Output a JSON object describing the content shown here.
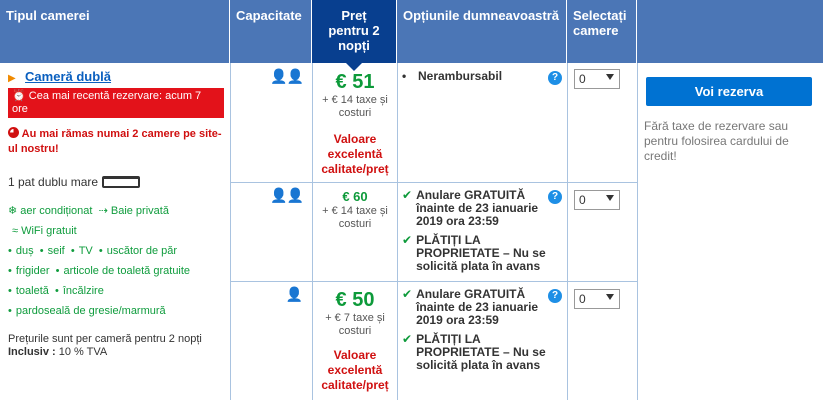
{
  "header": {
    "room_type": "Tipul camerei",
    "capacity": "Capacitate",
    "price_line1": "Preț",
    "price_line2": "pentru 2",
    "price_line3": "nopți",
    "options": "Opțiunile dumneavoastră",
    "select_line1": "Selectați",
    "select_line2": "camere"
  },
  "room": {
    "title": "Cameră dublă",
    "alert": "Cea mai recentă rezervare: acum 7 ore",
    "scarcity": "Au mai rămas numai 2 camere pe site-ul nostru!",
    "bed": "1 pat dublu mare",
    "amenities_row1": [
      "aer condiționat",
      "Baie privată"
    ],
    "wifi": "WiFi gratuit",
    "amenities_row2": [
      "duș",
      "seif",
      "TV",
      "uscător de păr"
    ],
    "amenities_row3": [
      "frigider",
      "articole de toaletă gratuite"
    ],
    "amenities_row4": [
      "toaletă",
      "încălzire"
    ],
    "amenities_row5": [
      "pardoseală de gresie/marmură"
    ],
    "prices_note": "Prețurile sunt per cameră pentru 2 nopți",
    "included_label": "Inclusiv :",
    "included_value": "10 % TVA"
  },
  "rows": [
    {
      "capacity_icon": "two-persons-icon",
      "price": "€ 51",
      "taxes": "+ € 14 taxe și costuri",
      "value_label": "Valoare excelentă calitate/preț",
      "options": [
        {
          "text": "Nerambursabil",
          "style": "bullet"
        }
      ],
      "select_value": "0"
    },
    {
      "capacity_icon": "two-persons-icon",
      "price": "€ 60",
      "taxes": "+ € 14 taxe și costuri",
      "options": [
        {
          "text": "Anulare GRATUITĂ înainte de 23 ianuarie 2019 ora 23:59",
          "style": "check"
        },
        {
          "text": "PLĂTIȚI LA PROPRIETATE – Nu se solicită plata în avans",
          "style": "check"
        }
      ],
      "select_value": "0"
    },
    {
      "capacity_icon": "one-person-icon",
      "price": "€ 50",
      "taxes": "+ € 7 taxe și costuri",
      "value_label": "Valoare excelentă calitate/preț",
      "options": [
        {
          "text": "Anulare GRATUITĂ înainte de 23 ianuarie 2019 ora 23:59",
          "style": "check"
        },
        {
          "text": "PLĂTIȚI LA PROPRIETATE – Nu se solicită plata în avans",
          "style": "check"
        }
      ],
      "select_value": "0"
    }
  ],
  "reserve_button": "Voi rezerva",
  "reserve_note": "Fără taxe de rezervare sau pentru folosirea cardului de credit!",
  "colors": {
    "header_bg": "#4b76b6",
    "price_header_bg": "#083f8f",
    "price_green": "#0d9a3a",
    "alert_red": "#e3121a",
    "button_blue": "#0072d2"
  }
}
